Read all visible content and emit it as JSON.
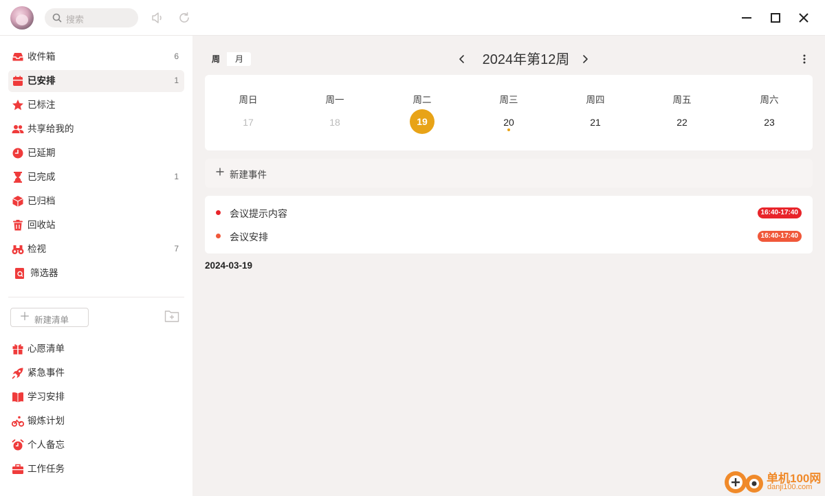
{
  "titlebar": {
    "search_placeholder": "搜索",
    "icons": [
      "avatar",
      "search-icon",
      "sound-icon",
      "refresh-icon",
      "minimize-icon",
      "maximize-icon",
      "close-icon"
    ]
  },
  "sidebar": {
    "items": [
      {
        "label": "收件箱",
        "count": "6",
        "icon": "inbox-icon"
      },
      {
        "label": "已安排",
        "count": "1",
        "icon": "calendar-icon",
        "active": true
      },
      {
        "label": "已标注",
        "count": "",
        "icon": "star-icon"
      },
      {
        "label": "共享给我的",
        "count": "",
        "icon": "people-icon"
      },
      {
        "label": "已延期",
        "count": "",
        "icon": "clock-icon"
      },
      {
        "label": "已完成",
        "count": "1",
        "icon": "hourglass-icon"
      },
      {
        "label": "已归档",
        "count": "",
        "icon": "box-icon"
      },
      {
        "label": "回收站",
        "count": "",
        "icon": "trash-icon"
      },
      {
        "label": "检视",
        "count": "7",
        "icon": "binoculars-icon"
      },
      {
        "label": "筛选器",
        "count": "",
        "icon": "filter-doc-icon"
      }
    ],
    "new_list_label": "新建清单",
    "lists": [
      {
        "label": "心愿清单",
        "icon": "gift-icon"
      },
      {
        "label": "紧急事件",
        "icon": "rocket-icon"
      },
      {
        "label": "学习安排",
        "icon": "book-icon"
      },
      {
        "label": "锻炼计划",
        "icon": "bike-icon"
      },
      {
        "label": "个人备忘",
        "icon": "alarm-icon"
      },
      {
        "label": "工作任务",
        "icon": "briefcase-icon"
      }
    ]
  },
  "main": {
    "view_tabs": [
      {
        "label": "周",
        "selected": true
      },
      {
        "label": "月",
        "selected": false
      }
    ],
    "week_title": "2024年第12周",
    "days": [
      {
        "name": "周日",
        "date": "17",
        "state": "past"
      },
      {
        "name": "周一",
        "date": "18",
        "state": "past"
      },
      {
        "name": "周二",
        "date": "19",
        "state": "today"
      },
      {
        "name": "周三",
        "date": "20",
        "state": "event"
      },
      {
        "name": "周四",
        "date": "21",
        "state": "normal"
      },
      {
        "name": "周五",
        "date": "22",
        "state": "normal"
      },
      {
        "name": "周六",
        "date": "23",
        "state": "normal"
      }
    ],
    "new_event_label": "新建事件",
    "events": [
      {
        "title": "会议提示内容",
        "time": "16:40-17:40",
        "color": "#e8242a"
      },
      {
        "title": "会议安排",
        "time": "16:40-17:40",
        "color": "#f0583a"
      }
    ],
    "date_label": "2024-03-19"
  },
  "colors": {
    "accent": "#ef3b3b",
    "today": "#e8a317"
  },
  "watermark": {
    "text": "单机100网",
    "url": "danji100.com"
  }
}
